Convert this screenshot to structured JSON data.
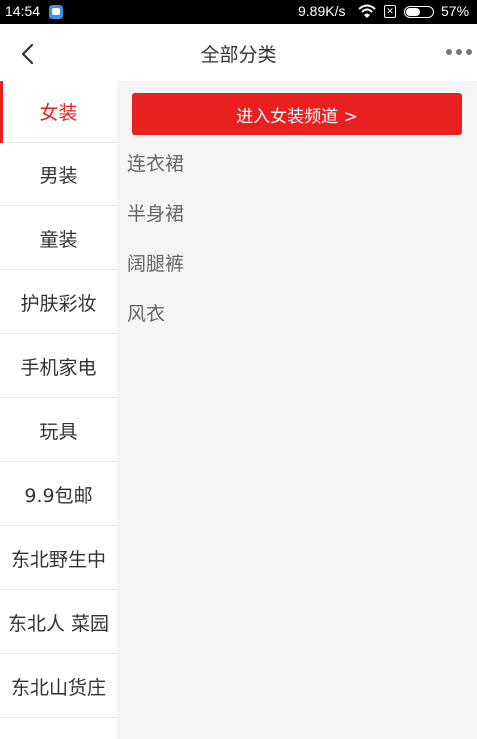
{
  "status_bar": {
    "time": "14:54",
    "network_speed": "9.89K/s",
    "battery_level": "57%",
    "battery_fraction": 0.57,
    "icons": [
      "app-notification-icon",
      "wifi-icon",
      "no-sim-icon",
      "battery-icon"
    ]
  },
  "header": {
    "title": "全部分类",
    "back_icon": "chevron-left-icon",
    "more_icon": "more-dots-icon"
  },
  "sidebar": {
    "items": [
      {
        "label": "女装",
        "active": true
      },
      {
        "label": "男装"
      },
      {
        "label": "童装"
      },
      {
        "label": "护肤彩妆"
      },
      {
        "label": "手机家电"
      },
      {
        "label": "玩具"
      },
      {
        "label": "9.9包邮"
      },
      {
        "label": "东北野生中"
      },
      {
        "label": "东北人 菜园"
      },
      {
        "label": "东北山货庄"
      }
    ]
  },
  "content": {
    "channel_button": "进入女装频道 >",
    "subcategories": [
      "连衣裙",
      "半身裙",
      "阔腿裤",
      "风衣"
    ]
  },
  "colors": {
    "accent": "#e8201f",
    "content_bg": "#f5f5f5",
    "status_bar_bg": "#000000"
  }
}
